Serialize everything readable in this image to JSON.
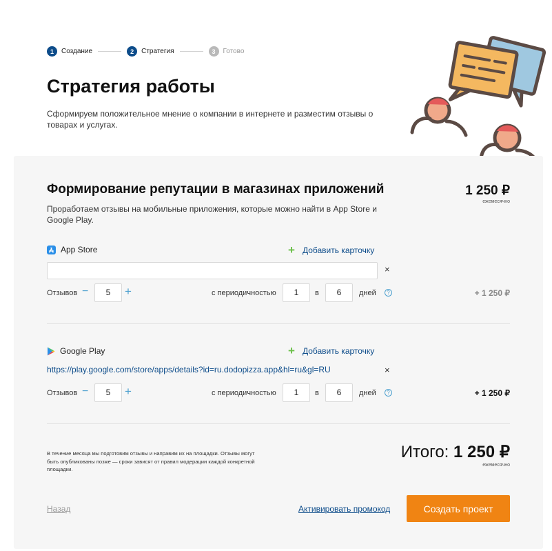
{
  "stepper": {
    "steps": [
      {
        "num": "1",
        "label": "Создание"
      },
      {
        "num": "2",
        "label": "Стратегия"
      },
      {
        "num": "3",
        "label": "Готово"
      }
    ]
  },
  "header": {
    "title": "Стратегия работы",
    "description": "Сформируем положительное мнение о компании в интернете и разместим отзывы о товарах и услугах."
  },
  "card": {
    "title": "Формирование репутации в магазинах приложений",
    "description": "Проработаем отзывы на мобильные приложения, которые можно найти в App Store и Google Play.",
    "price": "1 250 ₽",
    "price_note": "ежемесячно"
  },
  "appstore": {
    "name": "App Store",
    "add_card": "Добавить карточку",
    "url_value": "",
    "reviews_label": "Отзывов",
    "reviews_count": "5",
    "period_label": "с периодичностью",
    "period_a": "1",
    "in_label": "в",
    "period_b": "6",
    "days_label": "дней",
    "row_price": "+ 1 250 ₽"
  },
  "googleplay": {
    "name": "Google Play",
    "add_card": "Добавить карточку",
    "url_value": "https://play.google.com/store/apps/details?id=ru.dodopizza.app&hl=ru&gl=RU",
    "reviews_label": "Отзывов",
    "reviews_count": "5",
    "period_label": "с периодичностью",
    "period_a": "1",
    "in_label": "в",
    "period_b": "6",
    "days_label": "дней",
    "row_price": "+ 1 250 ₽"
  },
  "footer": {
    "note": "В течение месяца мы подготовим отзывы и направим их на площадки. Отзывы могут быть опубликованы позже — сроки зависят от правил модерации каждой конкретной площадки.",
    "total_label": "Итого:",
    "total_value": "1 250 ₽",
    "total_note": "ежемесячно",
    "back": "Назад",
    "promo": "Активировать промокод",
    "create": "Создать проект"
  },
  "icons": {
    "remove": "×",
    "minus": "−",
    "plus": "+",
    "help": "?"
  },
  "colors": {
    "accent": "#f08413",
    "link": "#0d4c8a",
    "add_plus": "#6cc04a",
    "stepper_active": "#0d4c8a"
  }
}
